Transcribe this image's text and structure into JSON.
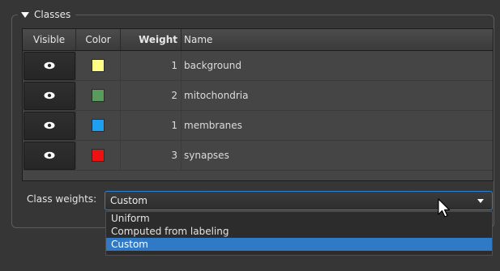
{
  "group": {
    "title": "Classes",
    "collapse_icon": "triangle-down-icon"
  },
  "table": {
    "headers": {
      "visible": "Visible",
      "color": "Color",
      "weight": "Weight",
      "name": "Name"
    },
    "rows": [
      {
        "color": "#ffff88",
        "weight": "1",
        "name": "background"
      },
      {
        "color": "#5a9a5a",
        "weight": "2",
        "name": "mitochondria"
      },
      {
        "color": "#1e9ff0",
        "weight": "1",
        "name": "membranes"
      },
      {
        "color": "#ee1111",
        "weight": "3",
        "name": "synapses"
      }
    ],
    "visibility_icon": "eye-icon"
  },
  "class_weights": {
    "label": "Class weights:",
    "selected": "Custom",
    "options": [
      "Uniform",
      "Computed from labeling",
      "Custom"
    ]
  },
  "colors": {
    "accent": "#2f79c6",
    "background": "#363636"
  }
}
